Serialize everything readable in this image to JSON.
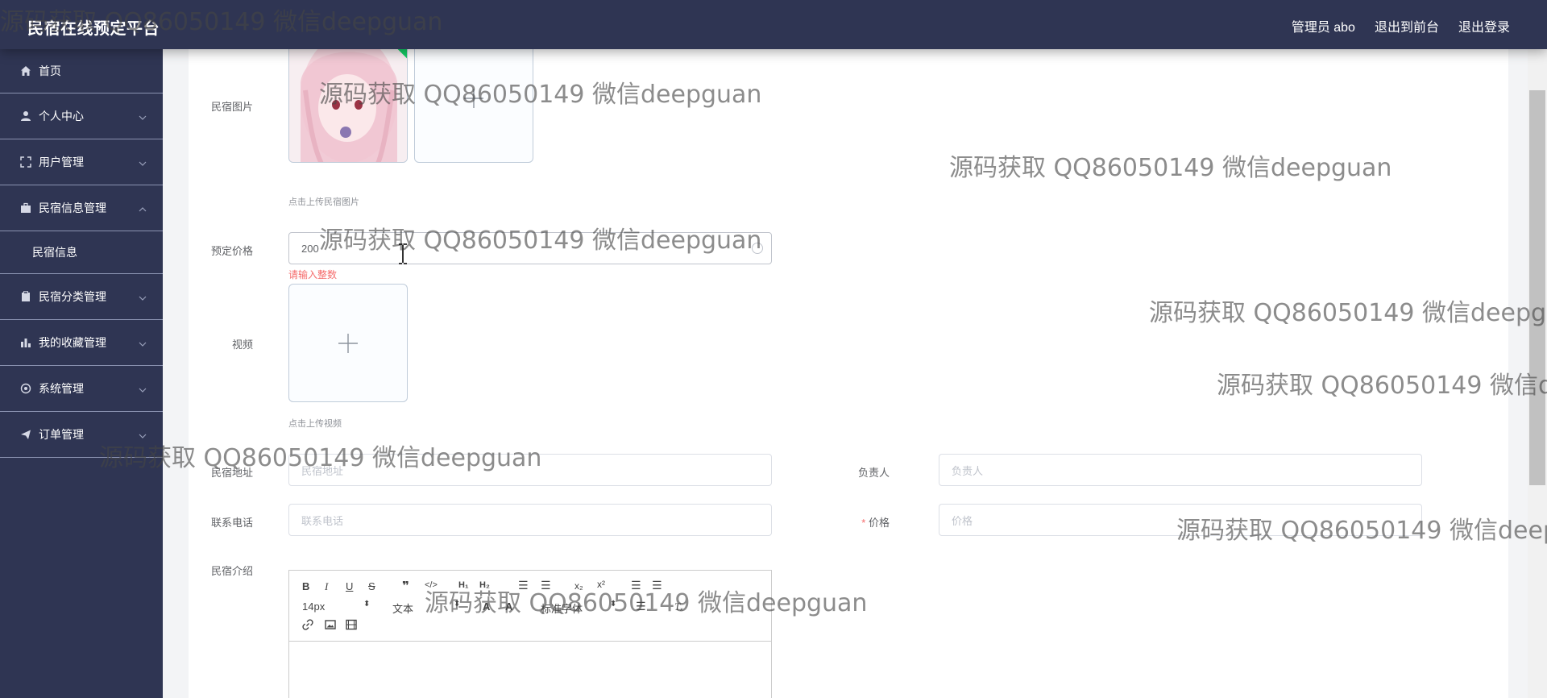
{
  "header": {
    "title": "民宿在线预定平台",
    "admin": "管理员 abo",
    "to_front": "退出到前台",
    "logout": "退出登录"
  },
  "sidebar": {
    "items": [
      {
        "label": "首页",
        "icon": "home-icon"
      },
      {
        "label": "个人中心",
        "icon": "user-icon"
      },
      {
        "label": "用户管理",
        "icon": "expand-icon"
      },
      {
        "label": "民宿信息管理",
        "icon": "briefcase-icon",
        "expanded": true,
        "children": [
          "民宿信息"
        ]
      },
      {
        "label": "民宿分类管理",
        "icon": "clipboard-icon"
      },
      {
        "label": "我的收藏管理",
        "icon": "bar-chart-icon"
      },
      {
        "label": "系统管理",
        "icon": "settings-icon"
      },
      {
        "label": "订单管理",
        "icon": "send-icon"
      }
    ]
  },
  "form": {
    "image_label": "民宿图片",
    "image_hint": "点击上传民宿图片",
    "price_label": "预定价格",
    "price_value": "200",
    "price_error": "请输入整数",
    "video_label": "视频",
    "video_hint": "点击上传视频",
    "address_label": "民宿地址",
    "address_placeholder": "民宿地址",
    "owner_label": "负责人",
    "owner_placeholder": "负责人",
    "phone_label": "联系电话",
    "phone_placeholder": "联系电话",
    "cost_required": "*",
    "cost_label": "价格",
    "cost_placeholder": "价格",
    "intro_label": "民宿介绍"
  },
  "editor": {
    "font_size": "14px",
    "text_type": "文本",
    "font_family": "标准字体"
  },
  "watermark": "源码获取 QQ86050149 微信deepguan",
  "colors": {
    "sidebar": "#2f3553",
    "error": "#f56c6c",
    "success": "#13ce66"
  }
}
